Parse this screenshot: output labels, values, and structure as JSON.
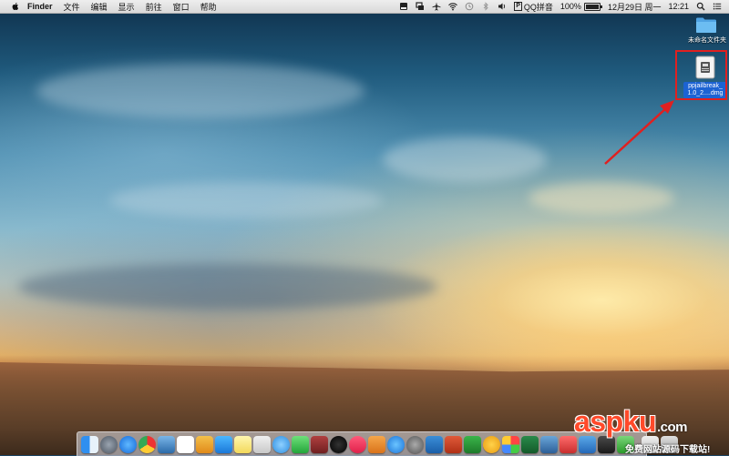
{
  "menubar": {
    "app_name": "Finder",
    "menus": [
      "文件",
      "编辑",
      "显示",
      "前往",
      "窗口",
      "帮助"
    ],
    "status": {
      "input_method": "QQ拼音",
      "battery": "100%",
      "battery_level": 1.0,
      "date": "12月29日 周一",
      "time": "12:21"
    }
  },
  "desktop": {
    "folder_label": "未命名文件夹",
    "dmg_label_line1": "ppjailbreak_",
    "dmg_label_line2": "1.0_2....dmg"
  },
  "watermark": {
    "logo": "aspku",
    "logo_suffix": ".com",
    "tagline": "免费网站源码下载站!"
  },
  "colors": {
    "annotation": "#e02020",
    "selection": "#1c63d3"
  }
}
